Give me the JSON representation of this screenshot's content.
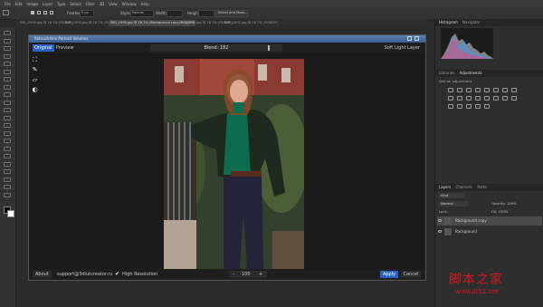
{
  "menubar": {
    "items": [
      "File",
      "Edit",
      "Image",
      "Layer",
      "Type",
      "Select",
      "Filter",
      "3D",
      "View",
      "Window",
      "Help"
    ]
  },
  "optionsbar": {
    "feather_label": "Feather:",
    "feather_value": "0 px",
    "style_label": "Style:",
    "style_value": "Normal",
    "width_label": "Width:",
    "height_label": "Height:",
    "mask_button": "Select and Mask..."
  },
  "tabs": [
    {
      "label": "IMG_1990.jpg @ 16.7% (RGB/8*)",
      "active": false
    },
    {
      "label": "IMG_1993.jpg @ 16.7% (RGB/8*)",
      "active": false
    },
    {
      "label": "IMG_1995.jpg @ 16.7% (Background copy, RGB/8*)",
      "active": true
    },
    {
      "label": "IMG_1998.jpg @ 16.7% (RGB/8*)",
      "active": false
    },
    {
      "label": "IMG_2001.jpg @ 16.7% (RGB/8*)",
      "active": false
    }
  ],
  "dialog": {
    "title": "Retouch4me Portrait Volumes",
    "mode_original": "Original",
    "mode_preview": "Preview",
    "blend_label": "Blend: 182",
    "blend_fraction": 0.9,
    "softlight_label": "Soft Light Layer",
    "about_label": "About",
    "support_email": "support@3dlutcreator.ru",
    "high_res_label": "High Resolution",
    "high_res_checked": true,
    "zoom_minus": "-",
    "zoom_value": "100",
    "zoom_plus": "+",
    "apply_label": "Apply",
    "cancel_label": "Cancel"
  },
  "rightpanel": {
    "histogram_tab": "Histogram",
    "navigator_tab": "Navigator",
    "libraries_tab": "Libraries",
    "adjustments_tab": "Adjustments",
    "add_adjustment": "Add an adjustment",
    "layers_tab": "Layers",
    "channels_tab": "Channels",
    "paths_tab": "Paths",
    "kind_label": "Kind",
    "blend_mode": "Normal",
    "opacity_label": "Opacity: 100%",
    "fill_label": "Fill: 100%",
    "lock_label": "Lock:",
    "layers": [
      {
        "name": "Background copy",
        "selected": true
      },
      {
        "name": "Background",
        "selected": false
      }
    ]
  },
  "watermark": {
    "line1": "脚本之家",
    "line2": "www.jb51.net"
  },
  "colors": {
    "accent": "#2962c6",
    "watermark": "#d6191d"
  }
}
